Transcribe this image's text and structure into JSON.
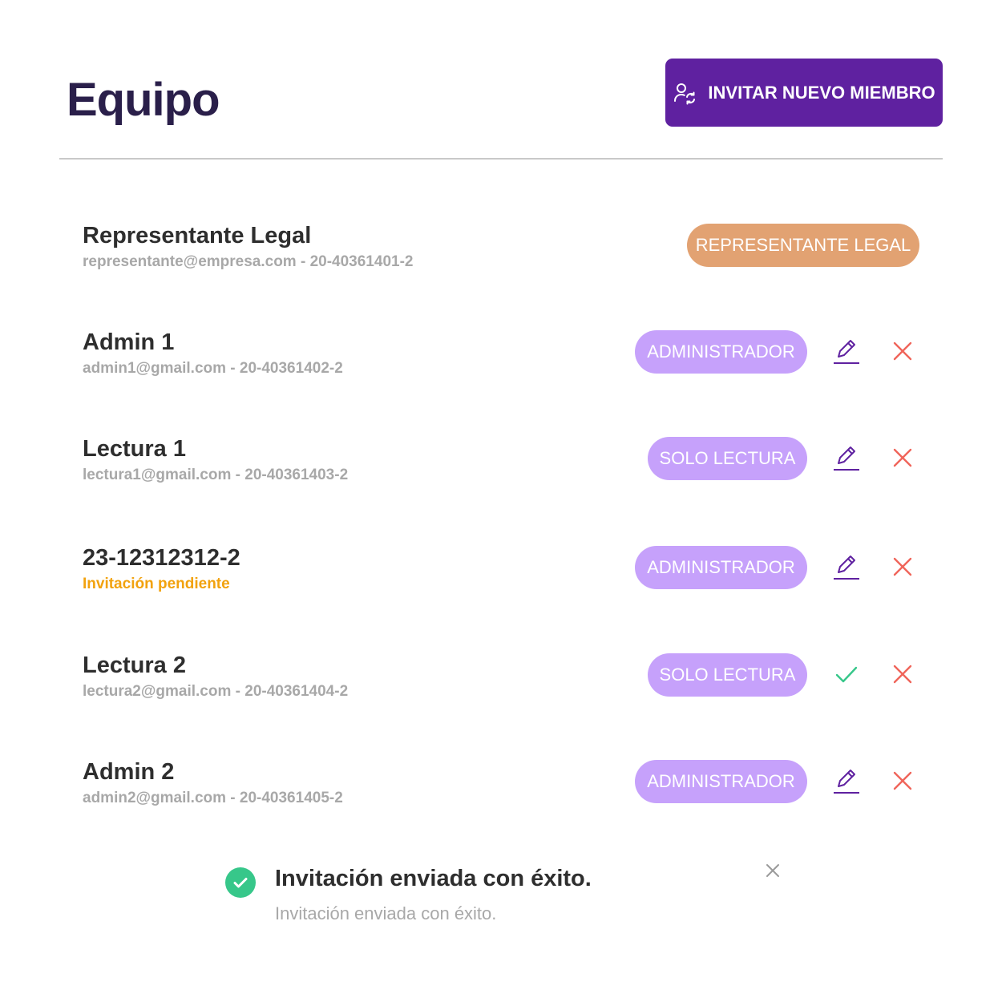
{
  "header": {
    "title": "Equipo",
    "invite_label": "INVITAR NUEVO MIEMBRO"
  },
  "members": [
    {
      "name": "Representante Legal",
      "sub": "representante@empresa.com - 20-40361401-2",
      "role": "REPRESENTANTE LEGAL",
      "actions": []
    },
    {
      "name": "Admin 1",
      "sub": "admin1@gmail.com - 20-40361402-2",
      "role": "ADMINISTRADOR",
      "actions": [
        "edit-icon",
        "delete-icon"
      ]
    },
    {
      "name": "Lectura 1",
      "sub": "lectura1@gmail.com - 20-40361403-2",
      "role": "SOLO LECTURA",
      "actions": [
        "edit-icon",
        "delete-icon"
      ]
    },
    {
      "name": "23-12312312-2",
      "sub": "Invitación pendiente",
      "role": "ADMINISTRADOR",
      "actions": [
        "edit-icon",
        "delete-icon"
      ]
    },
    {
      "name": "Lectura 2",
      "sub": "lectura2@gmail.com - 20-40361404-2",
      "role": "SOLO LECTURA",
      "actions": [
        "confirm-icon",
        "delete-icon"
      ]
    },
    {
      "name": "Admin 2",
      "sub": "admin2@gmail.com - 20-40361405-2",
      "role": "ADMINISTRADOR",
      "actions": [
        "edit-icon",
        "delete-icon"
      ]
    }
  ],
  "toast": {
    "title": "Invitación enviada con éxito.",
    "message": "Invitación enviada con éxito.",
    "icon": "success-check-icon",
    "close_icon": "close-icon"
  },
  "colors": {
    "primary": "#5f21a0",
    "badge_role": "#c6a1fb",
    "badge_legal": "#e2a272",
    "pending": "#f2a20e",
    "delete": "#f0655a",
    "confirm": "#37c78a",
    "edit": "#5f21a0"
  }
}
